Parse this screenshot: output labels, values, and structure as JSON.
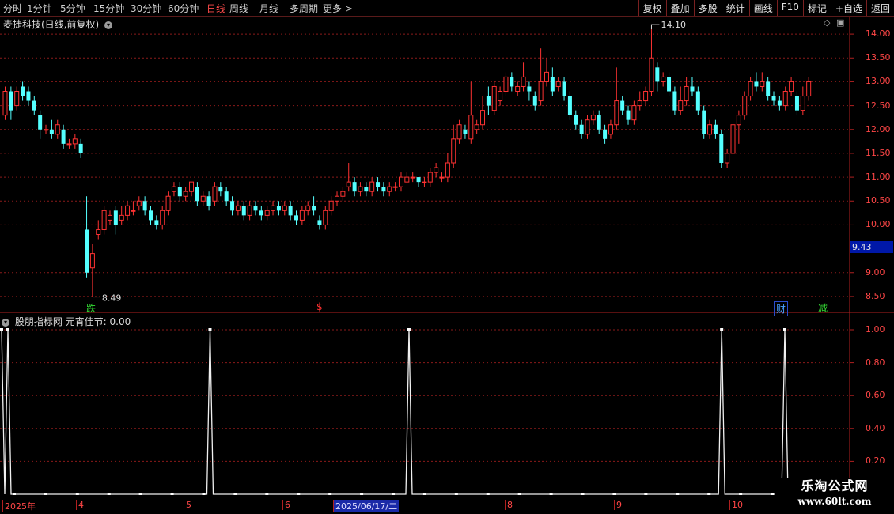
{
  "toolbar": {
    "periods": [
      "分时",
      "1分钟",
      "5分钟",
      "15分钟",
      "30分钟",
      "60分钟",
      "日线",
      "周线",
      "月线",
      "多周期",
      "更多 >"
    ],
    "active_period": "日线",
    "buttons": [
      "复权",
      "叠加",
      "多股",
      "统计",
      "画线",
      "F10",
      "标记",
      "+自选",
      "返回"
    ]
  },
  "main_chart": {
    "title": "麦捷科技(日线,前复权)",
    "price_labels": [
      "14.00",
      "13.50",
      "13.00",
      "12.50",
      "12.00",
      "11.50",
      "11.00",
      "10.50",
      "10.00",
      "9.00",
      "8.50"
    ],
    "high_marker": "14.10",
    "low_marker": "8.49",
    "current_price": "9.43",
    "tags": [
      {
        "text": "跌",
        "color": "#33dd33"
      },
      {
        "text": "$",
        "color": "#ff3030"
      },
      {
        "text": "财",
        "color": "#4aa0ff"
      },
      {
        "text": "减",
        "color": "#33dd33"
      }
    ]
  },
  "indicator": {
    "title": "股朋指标网 元宵佳节: 0.00",
    "axis_labels": [
      "1.00",
      "0.80",
      "0.60",
      "0.40",
      "0.20"
    ]
  },
  "date_axis": {
    "labels": [
      "2025年",
      "4",
      "5",
      "6",
      "2025/06/17/二",
      "8",
      "9",
      "10"
    ]
  },
  "watermark": {
    "line1": "乐淘公式网",
    "line2": "www.60lt.com"
  },
  "chart_data": [
    {
      "type": "candlestick",
      "title": "麦捷科技(日线,前复权)",
      "ylim": [
        8.3,
        14.3
      ],
      "high": 14.1,
      "low": 8.49,
      "candles": [
        [
          12.3,
          12.8,
          12.9,
          12.2
        ],
        [
          12.8,
          12.4,
          12.9,
          12.2
        ],
        [
          12.5,
          12.8,
          12.9,
          12.4
        ],
        [
          12.9,
          12.7,
          13.0,
          12.6
        ],
        [
          12.8,
          12.6,
          12.9,
          12.5
        ],
        [
          12.6,
          12.4,
          12.7,
          12.3
        ],
        [
          12.3,
          12.0,
          12.4,
          11.8
        ],
        [
          12.0,
          12.0,
          12.1,
          11.9
        ],
        [
          12.0,
          11.9,
          12.2,
          11.8
        ],
        [
          11.9,
          12.1,
          12.2,
          11.8
        ],
        [
          12.0,
          11.7,
          12.1,
          11.6
        ],
        [
          11.7,
          11.7,
          11.8,
          11.6
        ],
        [
          11.7,
          11.8,
          11.9,
          11.6
        ],
        [
          11.7,
          11.5,
          11.8,
          11.4
        ],
        [
          9.9,
          9.0,
          10.6,
          8.9
        ],
        [
          9.1,
          9.4,
          9.6,
          8.49
        ],
        [
          9.8,
          9.9,
          10.1,
          9.7
        ],
        [
          9.9,
          10.3,
          10.4,
          9.8
        ],
        [
          10.1,
          10.2,
          10.3,
          10.0
        ],
        [
          10.3,
          10.0,
          10.4,
          9.8
        ],
        [
          10.1,
          10.2,
          10.4,
          10.0
        ],
        [
          10.2,
          10.4,
          10.5,
          10.1
        ],
        [
          10.3,
          10.3,
          10.5,
          10.2
        ],
        [
          10.4,
          10.5,
          10.6,
          10.3
        ],
        [
          10.5,
          10.3,
          10.6,
          10.2
        ],
        [
          10.3,
          10.1,
          10.4,
          10.0
        ],
        [
          10.1,
          10.0,
          10.2,
          9.9
        ],
        [
          10.0,
          10.3,
          10.4,
          9.9
        ],
        [
          10.3,
          10.6,
          10.7,
          10.2
        ],
        [
          10.7,
          10.8,
          10.9,
          10.6
        ],
        [
          10.8,
          10.6,
          10.9,
          10.5
        ],
        [
          10.6,
          10.7,
          10.8,
          10.5
        ],
        [
          10.7,
          10.9,
          10.9,
          10.6
        ],
        [
          10.8,
          10.5,
          10.9,
          10.4
        ],
        [
          10.5,
          10.6,
          10.7,
          10.4
        ],
        [
          10.6,
          10.4,
          10.7,
          10.3
        ],
        [
          10.5,
          10.8,
          10.9,
          10.4
        ],
        [
          10.8,
          10.7,
          10.9,
          10.6
        ],
        [
          10.7,
          10.5,
          10.8,
          10.4
        ],
        [
          10.5,
          10.3,
          10.6,
          10.2
        ],
        [
          10.3,
          10.4,
          10.5,
          10.2
        ],
        [
          10.4,
          10.2,
          10.5,
          10.1
        ],
        [
          10.2,
          10.4,
          10.5,
          10.1
        ],
        [
          10.4,
          10.3,
          10.5,
          10.2
        ],
        [
          10.3,
          10.2,
          10.4,
          10.1
        ],
        [
          10.2,
          10.3,
          10.4,
          10.1
        ],
        [
          10.3,
          10.4,
          10.5,
          10.2
        ],
        [
          10.4,
          10.3,
          10.5,
          10.2
        ],
        [
          10.3,
          10.4,
          10.5,
          10.2
        ],
        [
          10.4,
          10.2,
          10.5,
          10.1
        ],
        [
          10.2,
          10.1,
          10.3,
          10.0
        ],
        [
          10.1,
          10.3,
          10.4,
          10.0
        ],
        [
          10.3,
          10.4,
          10.5,
          10.2
        ],
        [
          10.4,
          10.3,
          10.6,
          10.2
        ],
        [
          10.1,
          10.0,
          10.2,
          9.9
        ],
        [
          10.0,
          10.3,
          10.4,
          9.9
        ],
        [
          10.3,
          10.5,
          10.6,
          10.2
        ],
        [
          10.5,
          10.6,
          10.7,
          10.4
        ],
        [
          10.6,
          10.7,
          10.8,
          10.5
        ],
        [
          10.8,
          10.9,
          11.3,
          10.7
        ],
        [
          10.9,
          10.7,
          11.0,
          10.6
        ],
        [
          10.7,
          10.8,
          10.9,
          10.6
        ],
        [
          10.8,
          10.7,
          10.9,
          10.6
        ],
        [
          10.7,
          10.9,
          11.0,
          10.6
        ],
        [
          10.9,
          10.8,
          11.0,
          10.7
        ],
        [
          10.8,
          10.7,
          10.9,
          10.6
        ],
        [
          10.7,
          10.8,
          10.9,
          10.6
        ],
        [
          10.8,
          10.8,
          10.9,
          10.7
        ],
        [
          10.8,
          11.0,
          11.1,
          10.7
        ],
        [
          10.9,
          11.0,
          11.1,
          10.9
        ],
        [
          11.0,
          11.0,
          11.1,
          10.9
        ],
        [
          11.0,
          10.9,
          11.0,
          10.8
        ],
        [
          10.9,
          10.9,
          11.0,
          10.8
        ],
        [
          10.9,
          11.1,
          11.2,
          10.8
        ],
        [
          11.1,
          11.2,
          11.3,
          11.0
        ],
        [
          11.0,
          11.0,
          11.1,
          10.9
        ],
        [
          11.0,
          11.3,
          11.5,
          10.9
        ],
        [
          11.3,
          11.8,
          12.1,
          11.2
        ],
        [
          11.8,
          12.1,
          12.2,
          11.7
        ],
        [
          12.0,
          11.9,
          12.1,
          11.8
        ],
        [
          11.8,
          12.3,
          13.0,
          11.7
        ],
        [
          12.0,
          12.1,
          12.2,
          11.9
        ],
        [
          12.1,
          12.4,
          12.7,
          12.0
        ],
        [
          12.7,
          12.5,
          12.9,
          12.3
        ],
        [
          12.4,
          12.9,
          13.0,
          12.3
        ],
        [
          12.6,
          12.8,
          12.9,
          12.5
        ],
        [
          12.8,
          13.1,
          13.2,
          12.7
        ],
        [
          13.1,
          12.9,
          13.2,
          12.8
        ],
        [
          12.8,
          12.9,
          13.0,
          12.7
        ],
        [
          12.9,
          13.1,
          13.4,
          12.8
        ],
        [
          12.9,
          12.8,
          13.0,
          12.6
        ],
        [
          12.7,
          12.5,
          12.8,
          12.4
        ],
        [
          12.6,
          13.0,
          13.7,
          12.5
        ],
        [
          13.0,
          13.2,
          13.5,
          12.9
        ],
        [
          13.1,
          12.8,
          13.3,
          12.7
        ],
        [
          12.9,
          13.0,
          13.1,
          12.8
        ],
        [
          13.0,
          12.7,
          13.1,
          12.6
        ],
        [
          12.7,
          12.3,
          12.8,
          12.2
        ],
        [
          12.3,
          12.1,
          12.4,
          12.0
        ],
        [
          12.1,
          11.9,
          12.2,
          11.8
        ],
        [
          11.9,
          12.2,
          12.3,
          11.8
        ],
        [
          12.2,
          12.3,
          12.4,
          12.1
        ],
        [
          12.3,
          12.0,
          12.4,
          11.9
        ],
        [
          12.0,
          11.8,
          12.1,
          11.7
        ],
        [
          11.9,
          12.1,
          12.2,
          11.8
        ],
        [
          12.1,
          12.6,
          13.3,
          12.0
        ],
        [
          12.6,
          12.4,
          12.7,
          12.3
        ],
        [
          12.4,
          12.2,
          12.5,
          12.1
        ],
        [
          12.2,
          12.5,
          12.6,
          12.1
        ],
        [
          12.5,
          12.6,
          12.8,
          12.4
        ],
        [
          12.6,
          12.8,
          12.9,
          12.5
        ],
        [
          12.8,
          13.5,
          14.1,
          12.7
        ],
        [
          13.3,
          13.0,
          13.4,
          12.8
        ],
        [
          13.0,
          13.1,
          13.2,
          12.9
        ],
        [
          13.1,
          12.8,
          13.2,
          12.7
        ],
        [
          12.8,
          12.4,
          12.9,
          12.3
        ],
        [
          12.4,
          12.6,
          12.9,
          12.3
        ],
        [
          12.6,
          12.9,
          13.1,
          12.5
        ],
        [
          12.9,
          12.8,
          13.1,
          12.7
        ],
        [
          12.8,
          12.4,
          12.9,
          12.3
        ],
        [
          12.4,
          11.9,
          12.5,
          11.8
        ],
        [
          11.9,
          12.1,
          12.2,
          11.8
        ],
        [
          12.1,
          11.9,
          12.2,
          11.8
        ],
        [
          11.9,
          11.3,
          12.0,
          11.2
        ],
        [
          11.3,
          11.5,
          11.6,
          11.2
        ],
        [
          11.5,
          12.1,
          12.2,
          11.4
        ],
        [
          12.1,
          12.3,
          12.4,
          11.7
        ],
        [
          12.3,
          12.7,
          12.8,
          12.2
        ],
        [
          12.7,
          13.0,
          13.1,
          12.6
        ],
        [
          13.0,
          12.9,
          13.2,
          12.8
        ],
        [
          12.9,
          13.0,
          13.2,
          12.8
        ],
        [
          13.0,
          12.7,
          13.1,
          12.6
        ],
        [
          12.7,
          12.6,
          12.8,
          12.5
        ],
        [
          12.6,
          12.5,
          12.7,
          12.4
        ],
        [
          12.5,
          12.8,
          12.9,
          12.4
        ],
        [
          12.8,
          13.0,
          13.1,
          12.7
        ],
        [
          12.7,
          12.4,
          12.8,
          12.3
        ],
        [
          12.4,
          12.7,
          12.9,
          12.3
        ],
        [
          12.7,
          13.0,
          13.1,
          12.6
        ]
      ]
    },
    {
      "type": "line",
      "title": "股朋指标网 元宵佳节: 0.00",
      "ylim": [
        0,
        1
      ],
      "series": [
        {
          "values": [
            1,
            0,
            1,
            0,
            0,
            0,
            0,
            0,
            0,
            0,
            0,
            0,
            0,
            0,
            0,
            0,
            0,
            0,
            0,
            0,
            0,
            0,
            0,
            0,
            0,
            0,
            0,
            0,
            0,
            0,
            0,
            0,
            0,
            0,
            0,
            0,
            0,
            0,
            0,
            0,
            0,
            0,
            0,
            0,
            0,
            0,
            0,
            0,
            0,
            0,
            0,
            0,
            0,
            0,
            0,
            0,
            0,
            0,
            0,
            0,
            0,
            0,
            0,
            0,
            0,
            0,
            1,
            0,
            0,
            0,
            0,
            0,
            0,
            0,
            0,
            0,
            0,
            0,
            0,
            0,
            0,
            0,
            0,
            0,
            0,
            0,
            0,
            0,
            0,
            0,
            0,
            0,
            0,
            0,
            0,
            0,
            0,
            0,
            0,
            0,
            0,
            0,
            0,
            0,
            0,
            0,
            0,
            0,
            0,
            0,
            0,
            0,
            0,
            0,
            0,
            0,
            0,
            0,
            0,
            0,
            0,
            0,
            0,
            0,
            0,
            0,
            0,
            0,
            0,
            1,
            0,
            0,
            0,
            0,
            0,
            0,
            0,
            0,
            0,
            0,
            0,
            0,
            0,
            0,
            0,
            0,
            0,
            0,
            0,
            0,
            0,
            0,
            0,
            0,
            0,
            0,
            0,
            0,
            0,
            0,
            0,
            0,
            0,
            0,
            0,
            0,
            0,
            0,
            0,
            0,
            0,
            0,
            0,
            0,
            0,
            0,
            0,
            0,
            0,
            0,
            0,
            0,
            0,
            0,
            0,
            0,
            0,
            0,
            0,
            0,
            0,
            0,
            0,
            0,
            0,
            0,
            0,
            0,
            0,
            0,
            0,
            0,
            0,
            0,
            0,
            0,
            0,
            0,
            0,
            0,
            0,
            0,
            0,
            0,
            0,
            0,
            0,
            0,
            0,
            0,
            0,
            0,
            0,
            0,
            0,
            0,
            0,
            0,
            1,
            0,
            0,
            0,
            0,
            0,
            0,
            0,
            0,
            0,
            0,
            0,
            0,
            0,
            0,
            0,
            0,
            0,
            0,
            0,
            1,
            0,
            0
          ]
        }
      ]
    }
  ]
}
